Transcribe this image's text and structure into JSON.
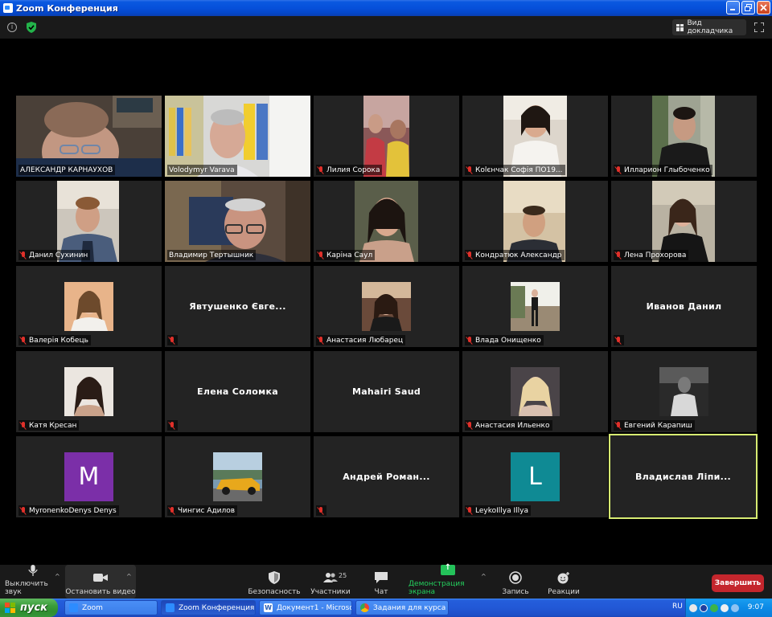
{
  "window": {
    "title": "Zoom Конференция"
  },
  "top": {
    "speaker_view_label": "Вид докладчика"
  },
  "participants": [
    {
      "name": "АЛЕКСАНДР КАРНАУХОВ",
      "muted": false,
      "video": true
    },
    {
      "name": "Volodymyr Varava",
      "muted": false,
      "video": true
    },
    {
      "name": "Лилия Сорока",
      "muted": true,
      "video": true
    },
    {
      "name": "Коlєнчак Софія ПО19...",
      "muted": true,
      "video": true
    },
    {
      "name": "Илларион Глыбоченко",
      "muted": true,
      "video": true
    },
    {
      "name": "Данил Сухинин",
      "muted": true,
      "video": true
    },
    {
      "name": "Владимир Тертышник",
      "muted": false,
      "video": true
    },
    {
      "name": "Каріна Саул",
      "muted": true,
      "video": true
    },
    {
      "name": "Кондратюк Александр",
      "muted": true,
      "video": true
    },
    {
      "name": "Лена Прохорова",
      "muted": true,
      "video": true
    },
    {
      "name": "Валерія Кобець",
      "muted": true,
      "video": false,
      "photo": true
    },
    {
      "name": "Явтушенко Євге...",
      "muted": true,
      "video": false,
      "center": true
    },
    {
      "name": "Анастасия Любарец",
      "muted": true,
      "video": false,
      "photo": true
    },
    {
      "name": "Влада Онищенко",
      "muted": true,
      "video": false,
      "photo": true
    },
    {
      "name": "Иванов Данил",
      "muted": true,
      "video": false,
      "center": true
    },
    {
      "name": "Катя Кресан",
      "muted": true,
      "video": false,
      "photo": true
    },
    {
      "name": "Елена Соломка",
      "muted": true,
      "video": false,
      "center": true
    },
    {
      "name": "Mahairi Saud",
      "muted": false,
      "video": false,
      "center": true
    },
    {
      "name": "Анастасия Ильенко",
      "muted": true,
      "video": false,
      "photo": true
    },
    {
      "name": "Евгений Карапиш",
      "muted": true,
      "video": false,
      "photo": true
    },
    {
      "name": "MyronenkoDenys Denys",
      "muted": true,
      "video": false,
      "avatar_letter": "M",
      "avatar_color": "#7b2fa8"
    },
    {
      "name": "Чингис Адилов",
      "muted": true,
      "video": false,
      "photo": true
    },
    {
      "name": "Андрей  Роман...",
      "muted": true,
      "video": false,
      "center": true
    },
    {
      "name": "LeykoIllya Illya",
      "muted": true,
      "video": false,
      "avatar_letter": "L",
      "avatar_color": "#0f8a94"
    },
    {
      "name": "Владислав  Ліпи...",
      "muted": false,
      "video": false,
      "center": true,
      "active": true
    }
  ],
  "toolbar": {
    "mute_label": "Выключить звук",
    "video_label": "Остановить видео",
    "security_label": "Безопасность",
    "participants_label": "Участники",
    "participants_count": "25",
    "chat_label": "Чат",
    "share_label": "Демонстрация экрана",
    "record_label": "Запись",
    "reactions_label": "Реакции",
    "end_label": "Завершить"
  },
  "taskbar": {
    "start_label": "пуск",
    "tasks": [
      {
        "label": "Zoom",
        "icon_color": "#2d8cff"
      },
      {
        "label": "Zoom Конференция",
        "icon_color": "#2d8cff",
        "active": true
      },
      {
        "label": "Документ1 - Microso...",
        "icon_color": "#2b5fb4"
      },
      {
        "label": "Задания для курса \"...",
        "icon_color": "#e8a22a"
      }
    ],
    "lang": "RU",
    "clock": "9:07"
  }
}
